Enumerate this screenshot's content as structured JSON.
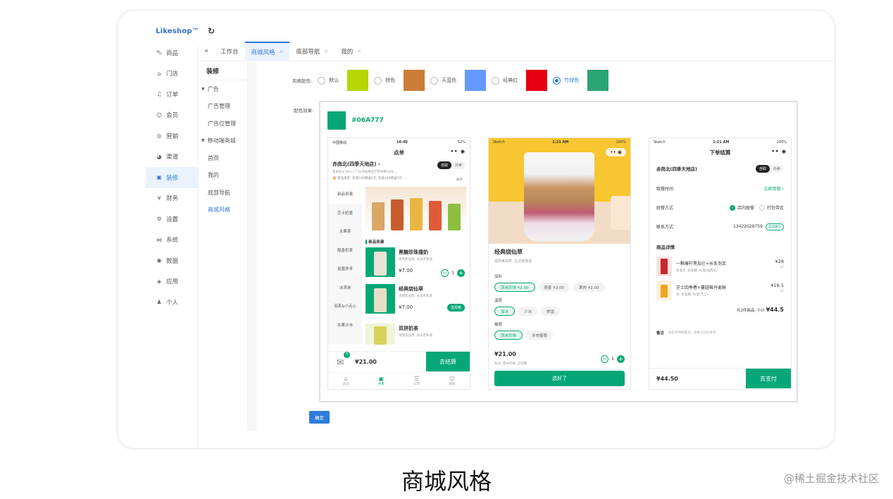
{
  "app": {
    "logo": "Likeshop™"
  },
  "sidebar": {
    "items": [
      {
        "icon": "cart-icon",
        "glyph": "⛍",
        "label": "商品"
      },
      {
        "icon": "store-icon",
        "glyph": "⌂",
        "label": "门店"
      },
      {
        "icon": "bell-icon",
        "glyph": "♫",
        "label": "订单"
      },
      {
        "icon": "user-icon",
        "glyph": "☺",
        "label": "会员"
      },
      {
        "icon": "target-icon",
        "glyph": "◎",
        "label": "营销"
      },
      {
        "icon": "channel-icon",
        "glyph": "◕",
        "label": "渠道"
      },
      {
        "icon": "decor-icon",
        "glyph": "▣",
        "label": "装修",
        "active": true
      },
      {
        "icon": "finance-icon",
        "glyph": "¥",
        "label": "财务"
      },
      {
        "icon": "settings-icon",
        "glyph": "⚙",
        "label": "设置"
      },
      {
        "icon": "system-icon",
        "glyph": "⋈",
        "label": "系统"
      },
      {
        "icon": "data-icon",
        "glyph": "◉",
        "label": "数据"
      },
      {
        "icon": "apps-icon",
        "glyph": "◈",
        "label": "应用"
      },
      {
        "icon": "person-icon",
        "glyph": "♟",
        "label": "个人"
      }
    ]
  },
  "tabs": [
    {
      "label": "工作台",
      "closable": false
    },
    {
      "label": "商城风格",
      "closable": true,
      "active": true
    },
    {
      "label": "底部导航",
      "closable": true
    },
    {
      "label": "我的",
      "closable": true
    }
  ],
  "subnav": {
    "title": "装修",
    "group1": "广告",
    "group1_items": [
      "广告管理",
      "广告位管理"
    ],
    "group2": "移动端商城",
    "group2_items": [
      "首页",
      "我的",
      "底部导航",
      "商城风格"
    ]
  },
  "style": {
    "label": "风格配色:",
    "options": [
      {
        "label": "默认",
        "color": "#B5D600"
      },
      {
        "label": "棕色",
        "color": "#CC7C36"
      },
      {
        "label": "天蓝色",
        "color": "#6599FF"
      },
      {
        "label": "经典红",
        "color": "#E60012"
      },
      {
        "label": "竹绿色",
        "color": "#2BA473",
        "selected": true
      }
    ],
    "effect_label": "配色效果:",
    "current_hex": "#06A777"
  },
  "phone1": {
    "time": "16:40",
    "carrier": "中国移动",
    "battery": "52%",
    "title": "点单",
    "store": "赤岗北(四季天地店)",
    "store_sub": "距离您4.3km | 广州市越秀区环市中路56号...",
    "notice": "新品限定: 充值100赠送2元, 充值200赠送5元, ...",
    "notice_more": "展开",
    "mode_on": "自取",
    "mode_off": "外卖",
    "categories": [
      "新品来袭",
      "芝士奶盖",
      "水果茶",
      "醇香奶茶",
      "益菌多多",
      "冰淇淋",
      "泡芙&小点心",
      "水果沙冰"
    ],
    "section": "新品来袭",
    "products": [
      {
        "name": "黑糖珍珠撞奶",
        "desc": "现熬焦仙草, 古法老味道",
        "price": "¥7.00",
        "qty": "1"
      },
      {
        "name": "经典烧仙草",
        "desc": "现熬焦仙草, 古法老味道",
        "price": "¥7.00",
        "action": "选规格"
      },
      {
        "name": "双拼奶茶",
        "desc": "现熬焦仙草, 古法老味道"
      }
    ],
    "cart_total": "¥21.00",
    "cart_badge": "3",
    "checkout": "去结算",
    "tabbar": [
      "首页",
      "点单",
      "订单",
      "我的"
    ]
  },
  "phone2": {
    "time": "1:21 AM",
    "carrier": "Sketch",
    "battery": "100%",
    "product": "经典烧仙草",
    "desc": "现熬焦仙草, 古法老味道",
    "g1": "加料",
    "g1_tags": [
      "西米珍珠 ¥2.00",
      "燕麦 ¥2.00",
      "果肉 ¥2.00"
    ],
    "g2": "温度",
    "g2_tags": [
      "加冰",
      "少冰",
      "常温"
    ],
    "g3": "糖度",
    "g3_tags": [
      "西米珍珠",
      "多肉葡萄"
    ],
    "price": "¥21.00",
    "spec": "加冰, 西米珍珠, 正常糖",
    "qty": "1",
    "button": "选好了"
  },
  "phone3": {
    "time": "1:21 AM",
    "carrier": "Sketch",
    "battery": "100%",
    "title": "下单结算",
    "store": "赤岗北(四季天地店)",
    "mode_on": "自取",
    "mode_off": "外卖",
    "pickup_label": "取餐时间",
    "pickup_value": "立即用餐",
    "dine_label": "就餐方式",
    "dine_on": "店内就餐",
    "dine_off": "打包带走",
    "contact_label": "联系方式",
    "contact_value": "13422028759",
    "contact_tag": "自动填写",
    "detail_title": "商品详情",
    "items": [
      {
        "name": "一颗爆柠黑加仑+长条泡芙",
        "spec": "标准冰, 标准糖, 标准(加西瓜)",
        "price": "¥28",
        "qty": "x1"
      },
      {
        "name": "芝士四季春+蔓越莓丹麦酥",
        "spec": "冰, 标准糖, 标准(芝士)",
        "price": "¥16.5",
        "qty": "x1"
      }
    ],
    "summary": "共2件商品, 小计",
    "subtotal": "¥44.5",
    "remark_label": "备注",
    "remark_placeholder": "如您有特殊需求，请备注您的要求",
    "total": "¥44.50",
    "pay": "去支付"
  },
  "confirm": "确定",
  "caption": "商城风格",
  "credit": "@稀土掘金技术社区"
}
